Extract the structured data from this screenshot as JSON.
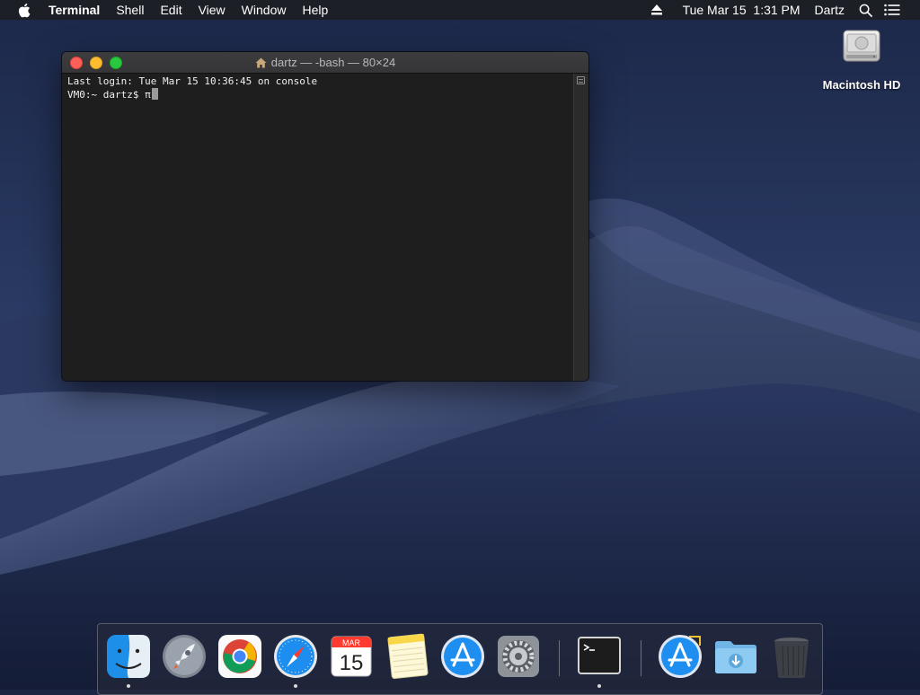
{
  "menubar": {
    "apple_icon": "apple-icon",
    "app_name": "Terminal",
    "menus": [
      "Shell",
      "Edit",
      "View",
      "Window",
      "Help"
    ],
    "status": {
      "eject_icon": "eject-icon",
      "datetime": "Tue Mar 15  1:31 PM",
      "user": "Dartz",
      "search_icon": "spotlight-icon",
      "notifications_icon": "notification-center-icon"
    }
  },
  "desktop": {
    "icons": [
      {
        "label": "Macintosh HD",
        "icon": "hard-drive-icon"
      }
    ]
  },
  "terminal": {
    "title": "dartz — -bash — 80×24",
    "title_icon": "home-icon",
    "lines": [
      "Last login: Tue Mar 15 10:36:45 on console",
      "VM0:~ dartz$ π"
    ]
  },
  "dock": {
    "apps": [
      {
        "name": "Finder",
        "icon": "finder-icon",
        "running": true
      },
      {
        "name": "Launchpad",
        "icon": "launchpad-icon",
        "running": false
      },
      {
        "name": "Google Chrome",
        "icon": "chrome-icon",
        "running": false
      },
      {
        "name": "Safari",
        "icon": "safari-icon",
        "running": true
      },
      {
        "name": "Calendar",
        "icon": "calendar-icon",
        "running": false,
        "month": "MAR",
        "day": "15"
      },
      {
        "name": "Notes",
        "icon": "notes-icon",
        "running": false
      },
      {
        "name": "App Store",
        "icon": "app-store-icon",
        "running": false
      },
      {
        "name": "System Preferences",
        "icon": "system-preferences-icon",
        "running": false
      },
      {
        "name": "Terminal",
        "icon": "terminal-icon",
        "running": true
      },
      {
        "name": "Install macOS",
        "icon": "app-store-installer-icon",
        "running": false
      },
      {
        "name": "Downloads",
        "icon": "downloads-folder-icon",
        "running": false
      },
      {
        "name": "Trash",
        "icon": "trash-icon",
        "running": false
      }
    ]
  }
}
